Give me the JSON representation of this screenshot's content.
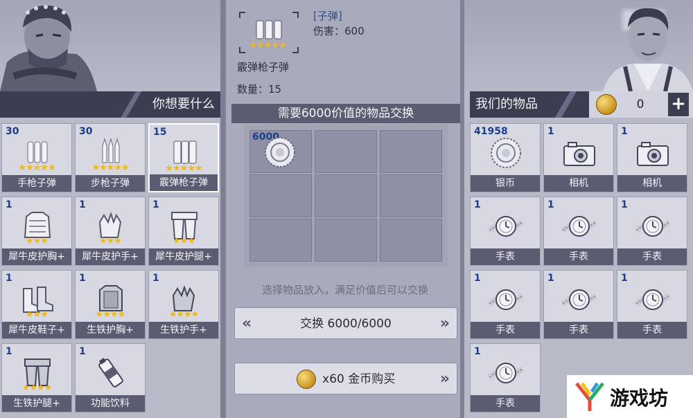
{
  "left": {
    "header_title": "你想要什么",
    "items": [
      {
        "count": "30",
        "label": "手枪子弹",
        "stars": "★★★★★",
        "icon": "pistol-bullets-icon"
      },
      {
        "count": "30",
        "label": "步枪子弹",
        "stars": "★★★★★",
        "icon": "rifle-bullets-icon"
      },
      {
        "count": "15",
        "label": "霰弹枪子弹",
        "stars": "★★★★★",
        "icon": "shotgun-shells-icon"
      },
      {
        "count": "1",
        "label": "犀牛皮护胸+",
        "stars": "★★★",
        "icon": "chest-armor-icon"
      },
      {
        "count": "1",
        "label": "犀牛皮护手+",
        "stars": "★★★",
        "icon": "gloves-icon"
      },
      {
        "count": "1",
        "label": "犀牛皮护腿+",
        "stars": "★★★",
        "icon": "leg-armor-icon"
      },
      {
        "count": "1",
        "label": "犀牛皮鞋子+",
        "stars": "★★★",
        "icon": "boots-icon"
      },
      {
        "count": "1",
        "label": "生铁护胸+",
        "stars": "★★★★",
        "icon": "iron-chest-icon"
      },
      {
        "count": "1",
        "label": "生铁护手+",
        "stars": "★★★★",
        "icon": "iron-gloves-icon"
      },
      {
        "count": "1",
        "label": "生铁护腿+",
        "stars": "★★★★",
        "icon": "iron-legs-icon"
      },
      {
        "count": "1",
        "label": "功能饮料",
        "stars": "",
        "icon": "energy-drink-icon"
      }
    ]
  },
  "detail": {
    "category": "[子弹]",
    "damage": "伤害：600",
    "item_stars": "★★★★★",
    "item_name": "霰弹枪子弹",
    "quantity": "数量：15",
    "exchange_title": "需要6000价值的物品交换",
    "slot_value": "6000",
    "hint": "选择物品放入，满足价值后可以交换",
    "exchange_button": "交换 6000/6000",
    "buy_button": "x60 金币购买"
  },
  "right": {
    "header_title": "我们的物品",
    "gold_amount": "0",
    "add_symbol": "+",
    "items": [
      {
        "count": "41958",
        "label": "银币",
        "icon": "silver-coin-icon"
      },
      {
        "count": "1",
        "label": "相机",
        "icon": "camera-icon"
      },
      {
        "count": "1",
        "label": "相机",
        "icon": "camera-icon"
      },
      {
        "count": "1",
        "label": "手表",
        "icon": "watch-icon"
      },
      {
        "count": "1",
        "label": "手表",
        "icon": "watch-icon"
      },
      {
        "count": "1",
        "label": "手表",
        "icon": "watch-icon"
      },
      {
        "count": "1",
        "label": "手表",
        "icon": "watch-icon"
      },
      {
        "count": "1",
        "label": "手表",
        "icon": "watch-icon"
      },
      {
        "count": "1",
        "label": "手表",
        "icon": "watch-icon"
      },
      {
        "count": "1",
        "label": "手表",
        "icon": "watch-icon"
      }
    ]
  },
  "watermark": {
    "text": "游戏坊"
  }
}
